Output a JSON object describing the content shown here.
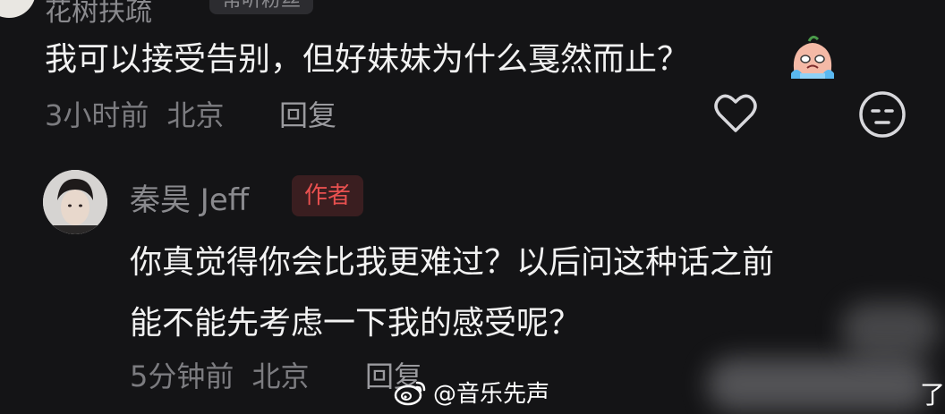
{
  "top_comment": {
    "username": "花树扶疏",
    "badge": "常听粉丝",
    "text": "我可以接受告别，但好妹妹为什么戛然而止？",
    "emoji_icon": "crying-face-icon",
    "time": "3小时前",
    "location": "北京",
    "reply_label": "回复",
    "like_icon": "heart-outline-icon",
    "reaction_icon": "neutral-face-icon"
  },
  "author_reply": {
    "username": "秦昊 Jeff",
    "badge": "作者",
    "badge_color": "#e8504f",
    "lines": [
      "你真觉得你会比我更难过？以后问这种话之前",
      "能不能先考虑一下我的感受呢？"
    ],
    "time": "5分钟前",
    "location": "北京",
    "reply_label": "回复"
  },
  "watermark": {
    "icon": "weibo-logo-icon",
    "text": "@音乐先声",
    "suffix": "了"
  }
}
